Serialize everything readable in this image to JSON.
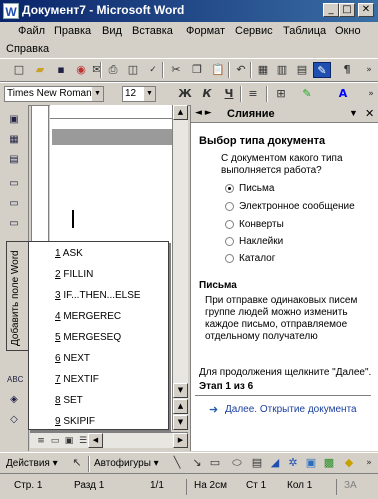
{
  "window": {
    "title": "Документ7 - Microsoft Word"
  },
  "menu": {
    "items": [
      {
        "label": "Файл"
      },
      {
        "label": "Правка"
      },
      {
        "label": "Вид"
      },
      {
        "label": "Вставка"
      },
      {
        "label": "Формат"
      },
      {
        "label": "Сервис"
      },
      {
        "label": "Таблица"
      },
      {
        "label": "Окно"
      },
      {
        "label": "Справка"
      }
    ]
  },
  "formatting": {
    "font_name": "Times New Roman",
    "font_size": "12",
    "bold": "Ж",
    "italic": "К",
    "underline": "Ч"
  },
  "taskpane": {
    "title": "Слияние",
    "section_title": "Выбор типа документа",
    "question": [
      "С документом какого типа",
      "выполняется работа?"
    ],
    "options": [
      {
        "label": "Письма",
        "selected": true
      },
      {
        "label": "Электронное сообщение",
        "selected": false
      },
      {
        "label": "Конверты",
        "selected": false
      },
      {
        "label": "Наклейки",
        "selected": false
      },
      {
        "label": "Каталог",
        "selected": false
      }
    ],
    "desc_title": "Письма",
    "desc_lines": [
      "При отправке одинаковых писем",
      "группе людей можно изменить",
      "каждое письмо, отправляемое",
      "отдельному получателю"
    ],
    "continue_text": "Для продолжения щелкните \"Далее\".",
    "step": "Этап 1 из 6",
    "next_link": "Далее. Открытие документа"
  },
  "popup": {
    "side_label": "Добавить поле Word",
    "items": [
      {
        "num": "1",
        "label": "ASK"
      },
      {
        "num": "2",
        "label": "FILLIN"
      },
      {
        "num": "3",
        "label": "IF...THEN...ELSE"
      },
      {
        "num": "4",
        "label": "MERGEREC"
      },
      {
        "num": "5",
        "label": "MERGESEQ"
      },
      {
        "num": "6",
        "label": "NEXT"
      },
      {
        "num": "7",
        "label": "NEXTIF"
      },
      {
        "num": "8",
        "label": "SET"
      },
      {
        "num": "9",
        "label": "SKIPIF"
      }
    ]
  },
  "drawing": {
    "actions_label": "Действия",
    "autoshapes_label": "Автофигуры"
  },
  "status": {
    "page": "Стр. 1",
    "section": "Разд 1",
    "pages": "1/1",
    "position": "На 2см",
    "line": "Ст 1",
    "column": "Кол 1",
    "mode": "ЗА"
  },
  "icons": {
    "toolbar": [
      "new-icon",
      "open-icon",
      "save-icon",
      "permission-icon",
      "email-icon",
      "print-icon",
      "print-preview-icon",
      "spelling-icon",
      "cut-icon",
      "copy-icon",
      "paste-icon",
      "undo-icon",
      "table-icon",
      "columns-icon",
      "show-hide-icon",
      "help-icon"
    ]
  }
}
